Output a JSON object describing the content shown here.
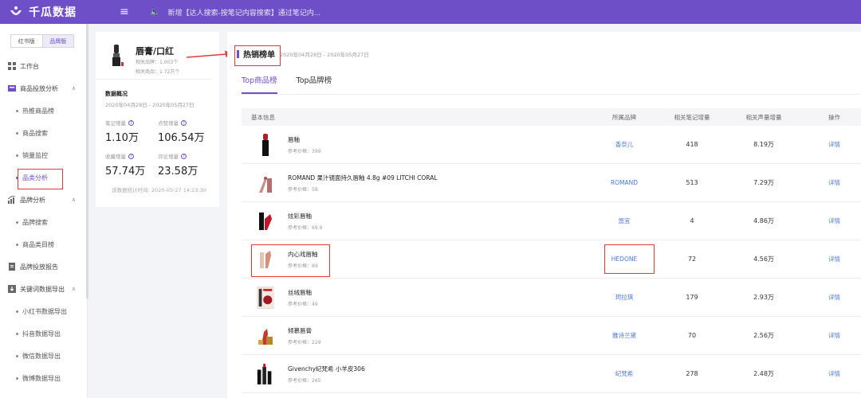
{
  "app": {
    "logo_text": "千瓜数据",
    "notice": "新增【达人搜索-按笔记内容搜索】通过笔记内..."
  },
  "sidebar": {
    "version_tabs": [
      "红书版",
      "品牌版"
    ],
    "items": [
      {
        "type": "group",
        "label": "工作台",
        "icon": "dashboard-icon"
      },
      {
        "type": "group",
        "label": "商品投放分析",
        "icon": "goods-icon",
        "caret": "∧"
      },
      {
        "type": "sub",
        "label": "热推商品榜"
      },
      {
        "type": "sub",
        "label": "商品搜索"
      },
      {
        "type": "sub",
        "label": "销量监控"
      },
      {
        "type": "sub",
        "label": "品类分析",
        "active": true
      },
      {
        "type": "group",
        "label": "品牌分析",
        "icon": "brand-chart-icon",
        "caret": "∧"
      },
      {
        "type": "sub",
        "label": "品牌搜索"
      },
      {
        "type": "sub",
        "label": "商品类目榜"
      },
      {
        "type": "group",
        "label": "品牌投放报告",
        "icon": "report-icon"
      },
      {
        "type": "group",
        "label": "关键词数据导出",
        "icon": "export-icon",
        "caret": "∧"
      },
      {
        "type": "sub",
        "label": "小红书数据导出"
      },
      {
        "type": "sub",
        "label": "抖音数据导出"
      },
      {
        "type": "sub",
        "label": "微信数据导出"
      },
      {
        "type": "sub",
        "label": "微博数据导出"
      }
    ]
  },
  "category_card": {
    "title": "唇膏/口红",
    "brands_label": "相关品牌：",
    "brands_value": "1,003个",
    "goods_label": "相关商品：",
    "goods_value": "1.72万个",
    "overview_title": "数据概况",
    "overview_date": "2020年04月28日 - 2020年05月27日",
    "metrics": [
      {
        "label": "笔记增量",
        "value": "1.10万"
      },
      {
        "label": "点赞增量",
        "value": "106.54万"
      },
      {
        "label": "收藏增量",
        "value": "57.74万"
      },
      {
        "label": "评论增量",
        "value": "23.58万"
      }
    ],
    "stat_time": "该数据统计时间: 2020-05-27 14:23:30"
  },
  "ranking": {
    "title": "热销榜单",
    "date": "2020年04月28日 - 2020年05月27日",
    "tabs": [
      "Top商品榜",
      "Top品牌榜"
    ],
    "columns": [
      "基本信息",
      "所属品牌",
      "相关笔记增量",
      "相关声量增量",
      "操作"
    ],
    "price_label": "参考价格：",
    "op_label": "详情",
    "rows": [
      {
        "name": "唇釉",
        "price": "399",
        "brand": "香奈儿",
        "notes": "418",
        "voice": "8.19万",
        "thumb": "lipstick-black-icon"
      },
      {
        "name": "ROMAND 果汁镜面持久唇釉 4.8g #09 LITCHI CORAL",
        "price": "58",
        "brand": "ROMAND",
        "notes": "513",
        "voice": "7.29万",
        "thumb": "lip-gloss-icon"
      },
      {
        "name": "炫彩唇釉",
        "price": "69.9",
        "brand": "悠宜",
        "notes": "4",
        "voice": "4.86万",
        "thumb": "lipstick-red-icon"
      },
      {
        "name": "内心戏唇釉",
        "price": "89",
        "brand": "HEDONE",
        "notes": "72",
        "voice": "4.56万",
        "thumb": "lipstick-nude-icon"
      },
      {
        "name": "丝绒唇釉",
        "price": "49",
        "brand": "珂拉琪",
        "notes": "179",
        "voice": "2.93万",
        "thumb": "lipstick-box-icon"
      },
      {
        "name": "倾慕唇膏",
        "price": "229",
        "brand": "雅诗兰黛",
        "notes": "70",
        "voice": "2.56万",
        "thumb": "lipstick-gold-icon"
      },
      {
        "name": "Givenchy纪梵希 小羊皮306",
        "price": "265",
        "brand": "纪梵希",
        "notes": "278",
        "voice": "2.48万",
        "thumb": "lipstick-trio-icon"
      }
    ]
  },
  "colors": {
    "accent": "#6f4fc8",
    "link": "#4a7ad8",
    "highlight": "#e23a3a"
  }
}
